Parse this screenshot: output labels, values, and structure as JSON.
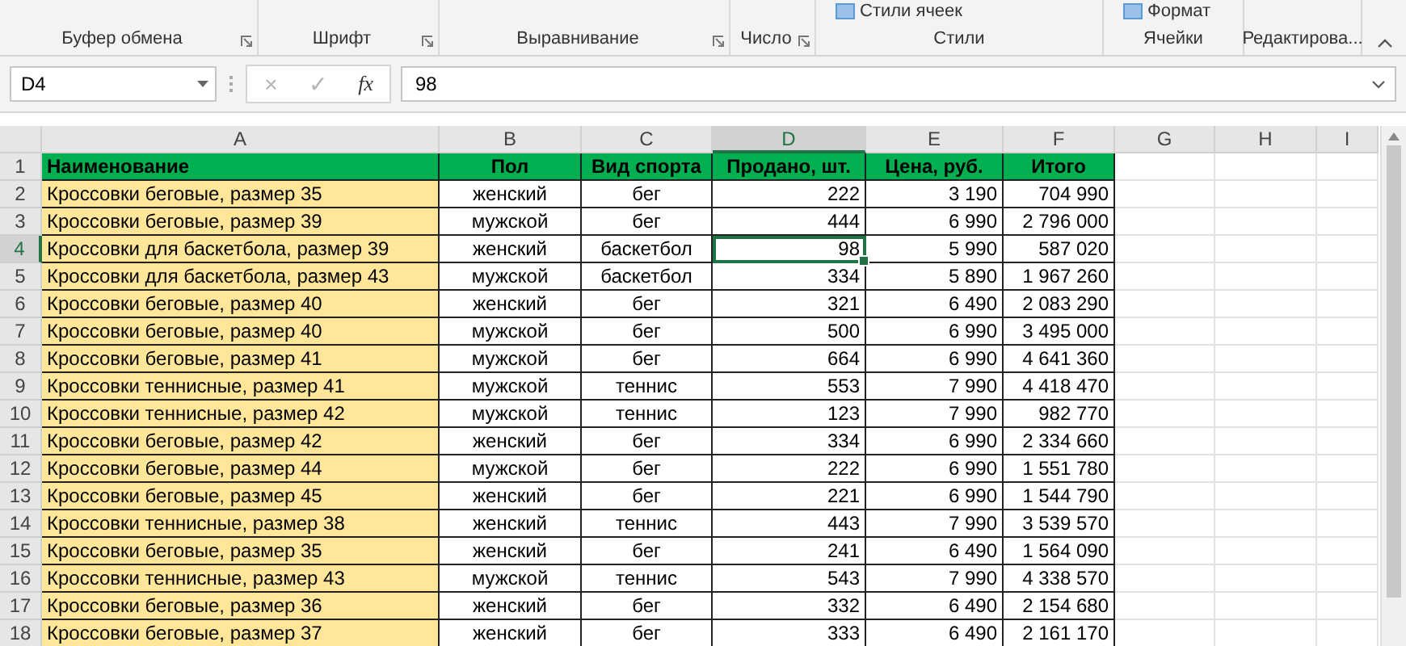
{
  "ribbon": {
    "groups": [
      {
        "label": "Буфер обмена",
        "launcher": true
      },
      {
        "label": "Шрифт",
        "launcher": true
      },
      {
        "label": "Выравнивание",
        "launcher": true
      },
      {
        "label": "Число",
        "launcher": true
      },
      {
        "label": "Стили",
        "launcher": false,
        "commands": [
          "Стили ячеек"
        ]
      },
      {
        "label": "Ячейки",
        "launcher": false,
        "commands": [
          "Формат"
        ]
      },
      {
        "label": "Редактирова...",
        "launcher": false
      }
    ]
  },
  "formula_bar": {
    "name_box": "D4",
    "buttons": [
      {
        "label": "×",
        "disabled": true
      },
      {
        "label": "✓",
        "disabled": true
      },
      {
        "label": "fx",
        "disabled": false
      }
    ],
    "value": "98"
  },
  "sheet": {
    "columns": [
      {
        "label": "A",
        "selected": false
      },
      {
        "label": "B",
        "selected": false
      },
      {
        "label": "C",
        "selected": false
      },
      {
        "label": "D",
        "selected": true
      },
      {
        "label": "E",
        "selected": false
      },
      {
        "label": "F",
        "selected": false
      },
      {
        "label": "G",
        "selected": false
      },
      {
        "label": "H",
        "selected": false
      },
      {
        "label": "I",
        "selected": false
      }
    ],
    "header": {
      "row": "1",
      "cells": [
        "Наименование",
        "Пол",
        "Вид спорта",
        "Продано, шт.",
        "Цена, руб.",
        "Итого"
      ]
    },
    "rows": [
      {
        "row": "2",
        "selected": false,
        "cells": [
          "Кроссовки беговые, размер 35",
          "женский",
          "бег",
          "222",
          "3 190",
          "704 990"
        ]
      },
      {
        "row": "3",
        "selected": false,
        "cells": [
          "Кроссовки беговые, размер 39",
          "мужской",
          "бег",
          "444",
          "6 990",
          "2 796 000"
        ]
      },
      {
        "row": "4",
        "selected": true,
        "cells": [
          "Кроссовки для баскетбола, размер 39",
          "женский",
          "баскетбол",
          "98",
          "5 990",
          "587 020"
        ]
      },
      {
        "row": "5",
        "selected": false,
        "cells": [
          "Кроссовки для баскетбола, размер 43",
          "мужской",
          "баскетбол",
          "334",
          "5 890",
          "1 967 260"
        ]
      },
      {
        "row": "6",
        "selected": false,
        "cells": [
          "Кроссовки беговые, размер 40",
          "женский",
          "бег",
          "321",
          "6 490",
          "2 083 290"
        ]
      },
      {
        "row": "7",
        "selected": false,
        "cells": [
          "Кроссовки беговые, размер 40",
          "мужской",
          "бег",
          "500",
          "6 990",
          "3 495 000"
        ]
      },
      {
        "row": "8",
        "selected": false,
        "cells": [
          "Кроссовки беговые, размер 41",
          "мужской",
          "бег",
          "664",
          "6 990",
          "4 641 360"
        ]
      },
      {
        "row": "9",
        "selected": false,
        "cells": [
          "Кроссовки теннисные, размер 41",
          "мужской",
          "теннис",
          "553",
          "7 990",
          "4 418 470"
        ]
      },
      {
        "row": "10",
        "selected": false,
        "cells": [
          "Кроссовки теннисные, размер 42",
          "мужской",
          "теннис",
          "123",
          "7 990",
          "982 770"
        ]
      },
      {
        "row": "11",
        "selected": false,
        "cells": [
          "Кроссовки беговые, размер 42",
          "женский",
          "бег",
          "334",
          "6 990",
          "2 334 660"
        ]
      },
      {
        "row": "12",
        "selected": false,
        "cells": [
          "Кроссовки беговые, размер 44",
          "мужской",
          "бег",
          "222",
          "6 990",
          "1 551 780"
        ]
      },
      {
        "row": "13",
        "selected": false,
        "cells": [
          "Кроссовки беговые, размер 45",
          "женский",
          "бег",
          "221",
          "6 990",
          "1 544 790"
        ]
      },
      {
        "row": "14",
        "selected": false,
        "cells": [
          "Кроссовки теннисные, размер 38",
          "женский",
          "теннис",
          "443",
          "7 990",
          "3 539 570"
        ]
      },
      {
        "row": "15",
        "selected": false,
        "cells": [
          "Кроссовки беговые, размер 35",
          "женский",
          "бег",
          "241",
          "6 490",
          "1 564 090"
        ]
      },
      {
        "row": "16",
        "selected": false,
        "cells": [
          "Кроссовки теннисные, размер 43",
          "мужской",
          "теннис",
          "543",
          "7 990",
          "4 338 570"
        ]
      },
      {
        "row": "17",
        "selected": false,
        "cells": [
          "Кроссовки беговые, размер 36",
          "женский",
          "бег",
          "332",
          "6 490",
          "2 154 680"
        ]
      },
      {
        "row": "18",
        "selected": false,
        "cells": [
          "Кроссовки беговые, размер 37",
          "женский",
          "бег",
          "333",
          "6 490",
          "2 161 170"
        ]
      }
    ]
  }
}
